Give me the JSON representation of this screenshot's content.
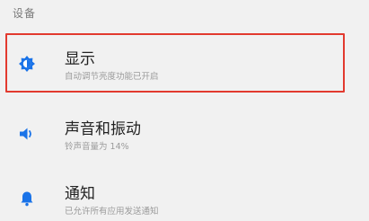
{
  "section": {
    "title": "设备"
  },
  "items": [
    {
      "icon": "brightness-icon",
      "title": "显示",
      "subtitle": "自动调节亮度功能已开启"
    },
    {
      "icon": "speaker-icon",
      "title": "声音和振动",
      "subtitle": "铃声音量为 14%"
    },
    {
      "icon": "bell-icon",
      "title": "通知",
      "subtitle": "已允许所有应用发送通知"
    }
  ],
  "colors": {
    "icon": "#1a73e8",
    "highlight": "#e23a2f",
    "background": "#f1f1f1"
  }
}
